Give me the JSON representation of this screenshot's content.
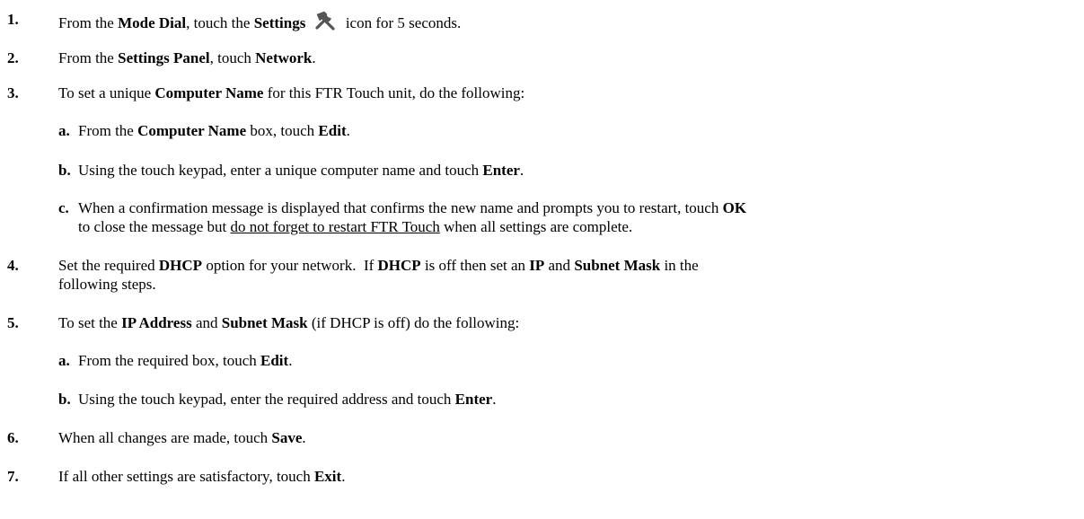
{
  "steps": {
    "s1": {
      "num": "1.",
      "a": "From the ",
      "b": "Mode Dial",
      "c": ", touch the ",
      "d": "Settings",
      "icon": "tools-wrench-hammer-icon",
      "e": " icon for 5 seconds."
    },
    "s2": {
      "num": "2.",
      "a": "From the ",
      "b": "Settings Panel",
      "c": ", touch ",
      "d": "Network",
      "e": "."
    },
    "s3": {
      "num": "3.",
      "a": "To set a unique ",
      "b": "Computer Name",
      "c": " for this FTR Touch unit, do the following:",
      "sub": {
        "a": {
          "letter": "a.",
          "t1": "From the ",
          "t2": "Computer Name",
          "t3": " box, touch ",
          "t4": "Edit",
          "t5": "."
        },
        "b": {
          "letter": "b.",
          "t1": "Using the touch keypad, enter a unique computer name and touch ",
          "t2": "Enter",
          "t3": "."
        },
        "c": {
          "letter": "c.",
          "t1": "When a confirmation message is displayed that confirms the new name and prompts you to restart, touch ",
          "t2": "OK",
          "t3": "to close the message but ",
          "t4": "do not forget to restart FTR Touch",
          "t5": " when all settings are complete."
        }
      }
    },
    "s4": {
      "num": "4.",
      "a": "Set the required ",
      "b": "DHCP",
      "c": " option for your network.  If ",
      "d": "DHCP",
      "e": " is off then set an ",
      "f": "IP",
      "g": " and ",
      "h": "Subnet Mask",
      "i": " in the",
      "j": "following steps."
    },
    "s5": {
      "num": "5.",
      "a": "To set the ",
      "b": "IP Address",
      "c": " and ",
      "d": "Subnet Mask",
      "e": " (if DHCP is off) do the following:",
      "sub": {
        "a": {
          "letter": "a.",
          "t1": "From the required box, touch ",
          "t2": "Edit",
          "t3": "."
        },
        "b": {
          "letter": "b.",
          "t1": "Using the touch keypad, enter the required address and touch ",
          "t2": "Enter",
          "t3": "."
        }
      }
    },
    "s6": {
      "num": "6.",
      "a": "When all changes are made, touch ",
      "b": "Save",
      "c": "."
    },
    "s7": {
      "num": "7.",
      "a": "If all other settings are satisfactory, touch ",
      "b": "Exit",
      "c": "."
    }
  }
}
